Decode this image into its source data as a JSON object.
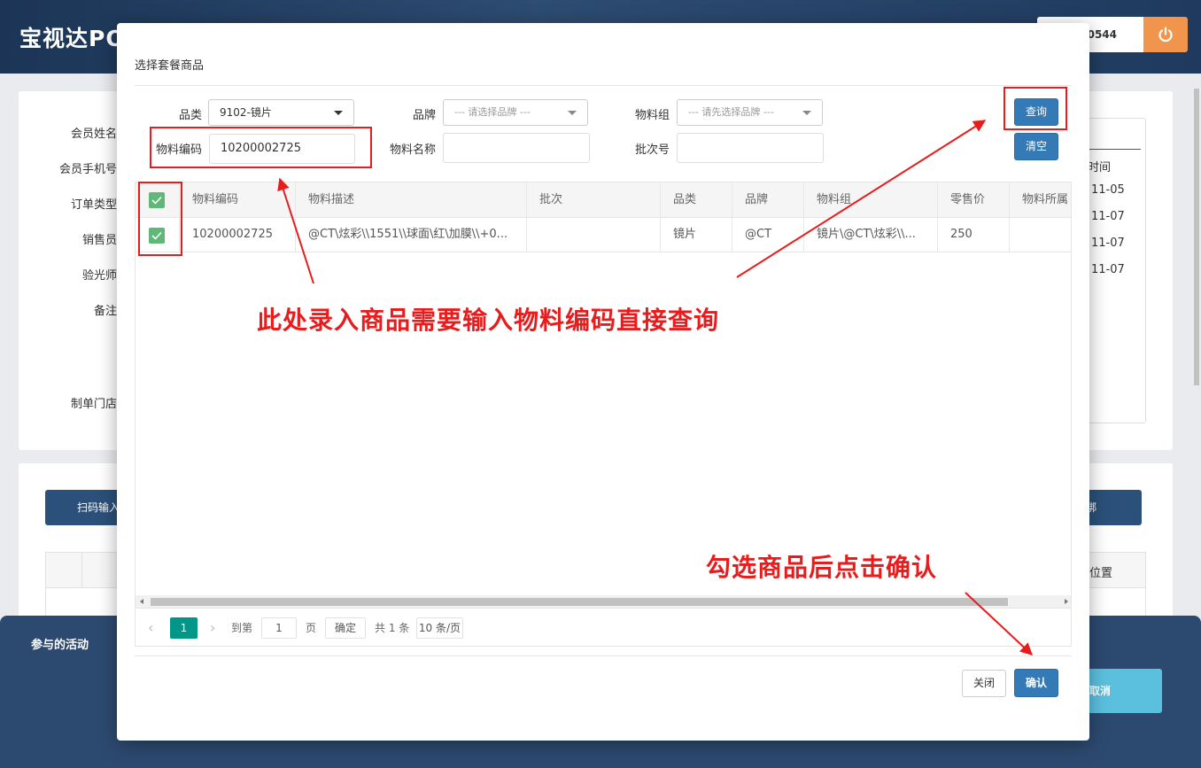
{
  "app": {
    "title": "宝视达POS",
    "user_text": "0544",
    "form_labels": [
      "会员姓名",
      "会员手机号",
      "订单类型",
      "销售员",
      "验光师",
      "备注",
      "制单门店"
    ],
    "history": {
      "header": "时间",
      "dates": [
        "11-05",
        "11-07",
        "11-07",
        "11-07"
      ]
    },
    "scan_button": "扫码输入",
    "bind_button": "绑",
    "position_col": "位置",
    "activity_label": "参与的活动",
    "cancel_button": "取消"
  },
  "modal": {
    "title": "选择套餐商品",
    "filters": {
      "category_label": "品类",
      "category_value": "9102-镜片",
      "brand_label": "品牌",
      "brand_placeholder": "--- 请选择品牌 ---",
      "material_group_label": "物料组",
      "material_group_placeholder": "--- 请先选择品牌 ---",
      "material_code_label": "物料编码",
      "material_code_value": "10200002725",
      "material_name_label": "物料名称",
      "material_name_value": "",
      "batch_label": "批次号",
      "batch_value": ""
    },
    "query_button": "查询",
    "clear_button": "清空",
    "table": {
      "columns": [
        "物料编码",
        "物料描述",
        "批次",
        "品类",
        "品牌",
        "物料组",
        "零售价",
        "物料所属"
      ],
      "rows": [
        {
          "checked": true,
          "cells": [
            "10200002725",
            "@CT\\炫彩\\\\1551\\\\球面\\红\\加膜\\\\+0...",
            "",
            "镜片",
            "@CT",
            "镜片\\@CT\\炫彩\\\\...",
            "250",
            ""
          ]
        }
      ]
    },
    "pager": {
      "current_page": "1",
      "goto_label": "到第",
      "goto_value": "1",
      "page_unit": "页",
      "confirm": "确定",
      "total": "共 1 条",
      "page_size": "10 条/页"
    },
    "close_button": "关闭",
    "confirm_button": "确认"
  },
  "annotations": {
    "main_note": "此处录入商品需要输入物料编码直接查询",
    "confirm_note": "勾选商品后点击确认",
    "color": "#e81c1c"
  },
  "colors": {
    "header_bg": "#1f3a5e",
    "primary": "#337ab7",
    "checkbox": "#5fb878",
    "pager_active": "#009688",
    "power_button": "#f0954b",
    "info": "#5bc0de"
  }
}
